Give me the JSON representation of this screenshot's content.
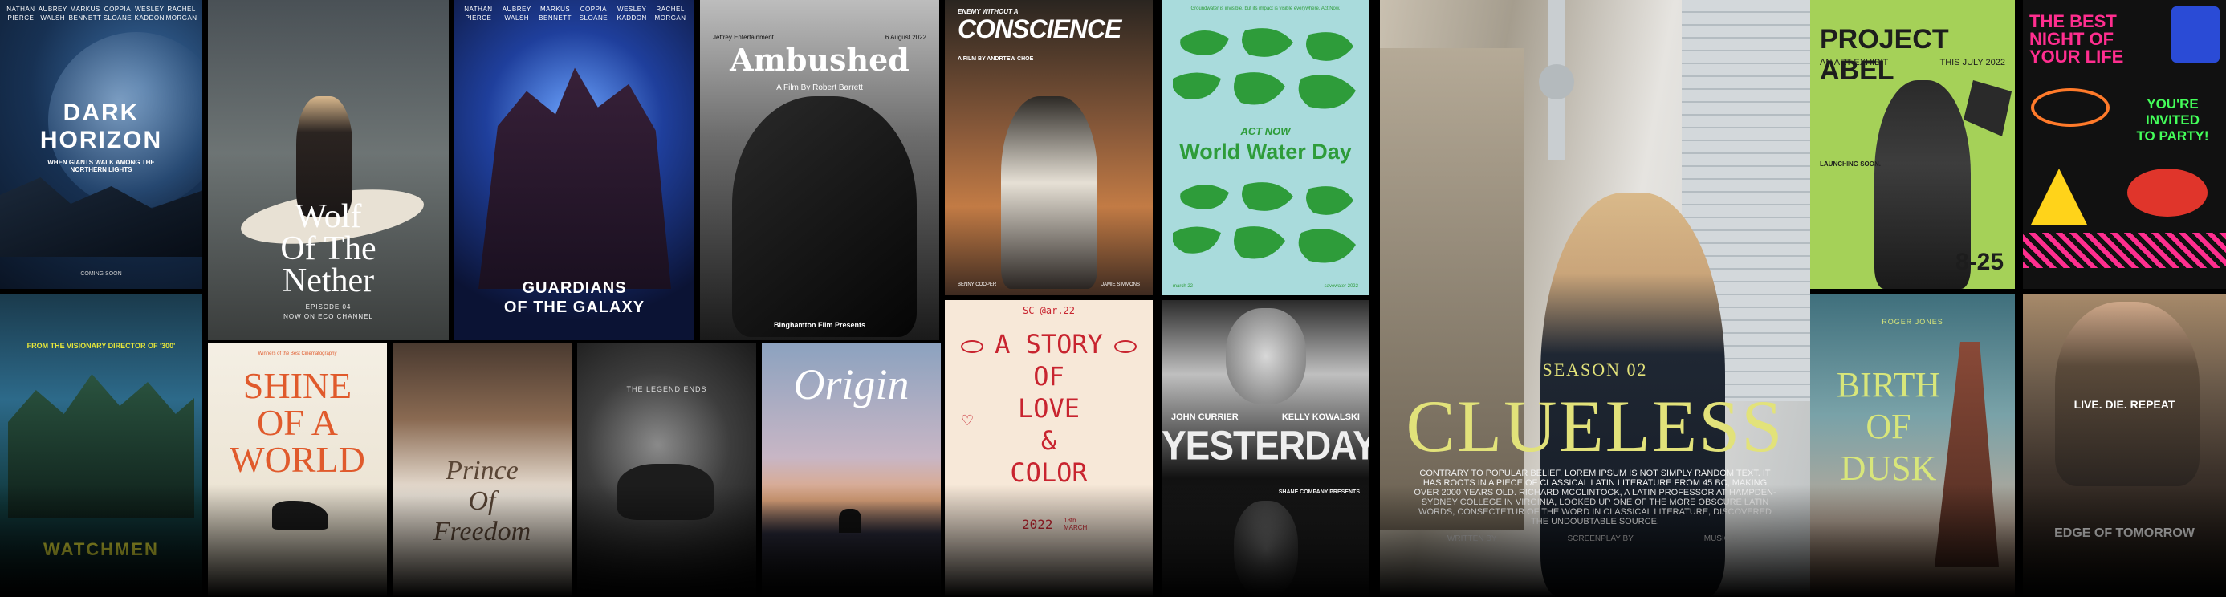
{
  "dark_horizon": {
    "credits": [
      "Nathan Pierce",
      "Aubrey Walsh",
      "Markus Bennett",
      "Coppia Sloane",
      "Wesley Kaddon",
      "Rachel Morgan"
    ],
    "title_1": "DARK",
    "title_2": "HORIZON",
    "tagline": "WHEN GIANTS WALK AMONG THE NORTHERN LIGHTS",
    "footer": "COMING SOON"
  },
  "wolf": {
    "title_1": "Wolf",
    "title_2": "Of The",
    "title_3": "Nether",
    "episode": "EPISODE 04",
    "channel": "NOW ON ECO CHANNEL"
  },
  "guardians": {
    "credits": [
      "Nathan Pierce",
      "Aubrey Walsh",
      "Markus Bennett",
      "Coppia Sloane",
      "Wesley Kaddon",
      "Rachel Morgan"
    ],
    "title_1": "GUARDIANS",
    "title_2": "OF THE GALAXY"
  },
  "ambushed": {
    "company": "Jeffrey Entertainment",
    "date": "6 August 2022",
    "title": "Ambushed",
    "byline": "A Film By Robert Barrett",
    "presents": "Binghamton Film Presents"
  },
  "conscience": {
    "pretitle": "ENEMY WITHOUT A",
    "title": "CONSCIENCE",
    "byline": "A FILM BY ANDRTEW CHOE",
    "left_credit": "BENNY COOPER",
    "right_credit": "JAMIE SIMMONS"
  },
  "water": {
    "top_text": "Groundwater is invisible, but its impact is visible everywhere. Act Now.",
    "act": "ACT NOW",
    "title": "World Water Day",
    "left_footer": "march 22",
    "right_footer": "savewater 2022"
  },
  "clueless": {
    "season": "SEASON 02",
    "title": "CLUELESS",
    "blurb": "CONTRARY TO POPULAR BELIEF, LOREM IPSUM IS NOT SIMPLY RANDOM TEXT. IT HAS ROOTS IN A PIECE OF CLASSICAL LATIN LITERATURE FROM 45 BC, MAKING OVER 2000 YEARS OLD. RICHARD MCCLINTOCK, A LATIN PROFESSOR AT HAMPDEN-SYDNEY COLLEGE IN VIRGINIA, LOOKED UP ONE OF THE MORE OBSCURE LATIN WORDS, CONSECTETUR OF THE WORD IN CLASSICAL LITERATURE, DISCOVERED THE UNDOUBTABLE SOURCE.",
    "credits": [
      "WRITTEN BY",
      "SCREENPLAY BY",
      "MUSIC BY"
    ]
  },
  "project_abel": {
    "title_1": "PROJECT ABEL",
    "subtitle": "AN ART EXHIBIT",
    "when": "THIS JULY 2022",
    "launching": "LAUNCHING SOON.",
    "dates": "8-25"
  },
  "party": {
    "title_1": "THE BEST",
    "title_2": "NIGHT OF",
    "title_3": "YOUR LIFE",
    "invite_1": "YOU'RE",
    "invite_2": "INVITED",
    "invite_3": "TO PARTY!"
  },
  "watchmen": {
    "tagline": "FROM THE VISIONARY DIRECTOR OF '300'",
    "title": "WATCHMEN"
  },
  "shine": {
    "top": "Winners of the Best Cinematography",
    "title_1": "SHINE",
    "title_2": "OF A",
    "title_3": "WORLD"
  },
  "prince": {
    "title_1": "Prince",
    "title_2": "Of",
    "title_3": "Freedom"
  },
  "legend": {
    "title": "THE LEGEND ENDS"
  },
  "origin": {
    "title": "Origin"
  },
  "story": {
    "top": "SC @ar.22",
    "title_1": "A STORY",
    "title_2": "OF",
    "title_3": "LOVE",
    "title_4": "&",
    "title_5": "COLOR",
    "year": "2022",
    "date": "18th MARCH"
  },
  "yesterday": {
    "actor_1": "JOHN CURRIER",
    "actor_2": "KELLY KOWALSKI",
    "title": "YESTERDAY",
    "presents": "SHANE COMPANY PRESENTS"
  },
  "birth": {
    "author": "ROGER JONES",
    "title_1": "BIRTH",
    "title_2": "OF",
    "title_3": "DUSK"
  },
  "edge": {
    "tagline": "LIVE. DIE. REPEAT",
    "title": "EDGE OF TOMORROW"
  },
  "colors": {
    "water_bg": "#a9dbdc",
    "water_green": "#2e9c3a",
    "abel_bg": "#a5d158",
    "shine_orange": "#e05a2c",
    "story_red": "#c8242f",
    "birth_yellow": "#d8e67a",
    "party_pink": "#ff2e8f",
    "party_green": "#44ff5a"
  }
}
